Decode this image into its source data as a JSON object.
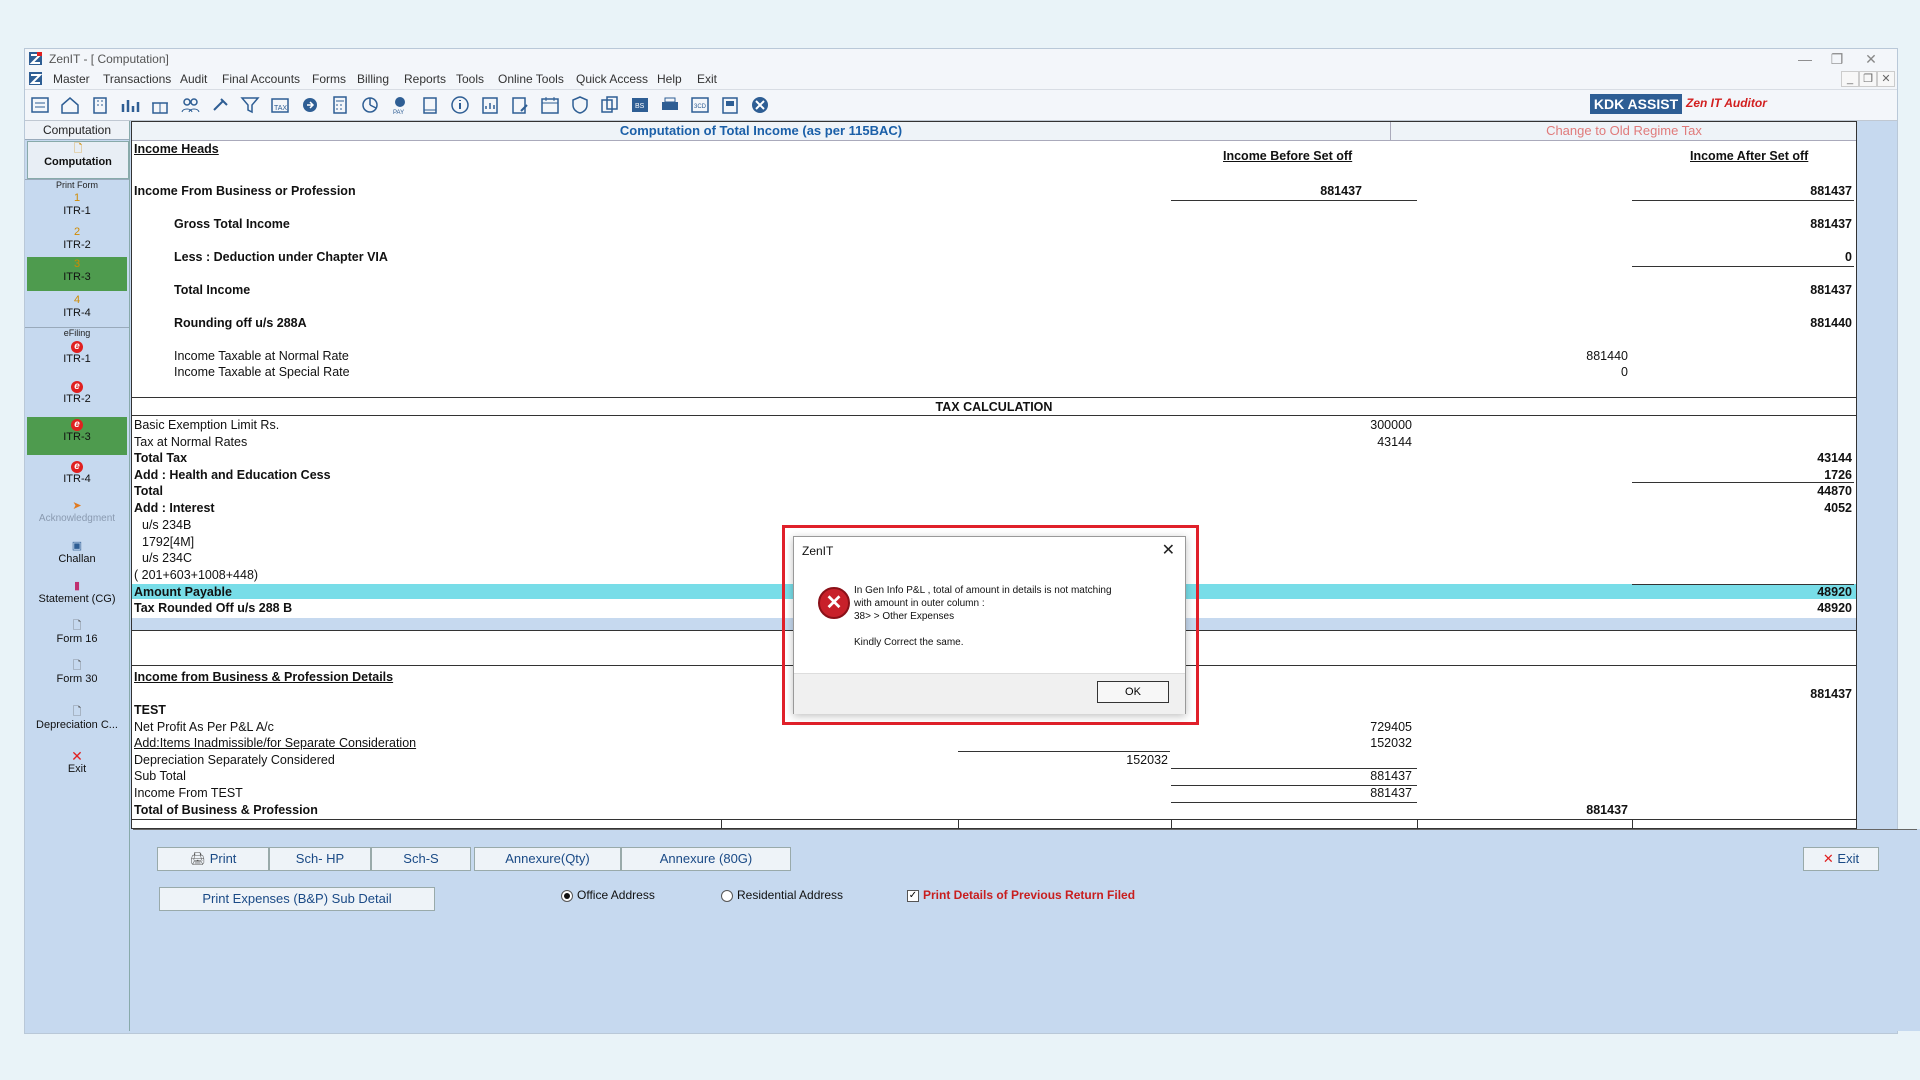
{
  "app": {
    "title": "ZenIT - [ Computation]"
  },
  "menu": [
    "Master",
    "Transactions",
    "Audit",
    "Final Accounts",
    "Forms",
    "Billing",
    "Reports",
    "Tools",
    "Online Tools",
    "Quick Access",
    "Help",
    "Exit"
  ],
  "branding": {
    "kdk": "KDK ASSIST",
    "zen": "Zen IT Auditor"
  },
  "sidebar": {
    "header": "Computation",
    "computation": "Computation",
    "print_form": "Print Form",
    "itr": [
      {
        "num": "1",
        "label": "ITR-1"
      },
      {
        "num": "2",
        "label": "ITR-2"
      },
      {
        "num": "3",
        "label": "ITR-3"
      },
      {
        "num": "4",
        "label": "ITR-4"
      }
    ],
    "efiling": "eFiling",
    "efile": [
      "ITR-1",
      "ITR-2",
      "ITR-3",
      "ITR-4"
    ],
    "acknowledgment": "Acknowledgment",
    "challan": "Challan",
    "statement": "Statement (CG)",
    "form16": "Form 16",
    "form30": "Form 30",
    "depreciation": "Depreciation C...",
    "exit": "Exit"
  },
  "sheet": {
    "title": "Computation of Total Income (as per 115BAC)",
    "old_regime": "Change to Old Regime Tax",
    "income_heads": "Income Heads",
    "col_before": "Income Before Set off",
    "col_after": "Income After Set off",
    "business_income_label": "Income From Business or Profession",
    "business_income_before": "881437",
    "business_income_after": "881437",
    "gti_label": "Gross Total Income",
    "gti_value": "881437",
    "deduction_label": "Less : Deduction under Chapter VIA",
    "deduction_value": "0",
    "total_income_label": "Total Income",
    "total_income_value": "881437",
    "rounding_label": "Rounding off u/s 288A",
    "rounding_value": "881440",
    "normal_rate_label": "Income Taxable at Normal Rate",
    "normal_rate_value": "881440",
    "special_rate_label": "Income Taxable at Special Rate",
    "special_rate_value": "0",
    "tax_calc": "TAX CALCULATION",
    "exemption_label": "Basic Exemption Limit Rs.",
    "exemption_value": "300000",
    "tax_normal_label": "Tax at Normal Rates",
    "tax_normal_value": "43144",
    "total_tax_label": "Total Tax",
    "total_tax_value": "43144",
    "cess_label": "Add : Health and Education Cess",
    "cess_value": "1726",
    "total_label": "Total",
    "total_value": "44870",
    "interest_label": "Add : Interest",
    "interest_value": "4052",
    "u234b": "u/s 234B",
    "m1792": "1792[4M]",
    "u234c": "u/s 234C",
    "breakup": "(  201+603+1008+448)",
    "payable_label": "Amount Payable",
    "payable_value": "48920",
    "rounded_label": "Tax Rounded Off u/s 288 B",
    "rounded_value": "48920",
    "bp_details": "Income from Business & Profession Details",
    "bp_total_top": "881437",
    "test": "TEST",
    "net_profit_label": "Net Profit As Per P&L A/c",
    "net_profit_value": "729405",
    "inadmissible_label": "Add:Items Inadmissible/for Separate Consideration",
    "inadmissible_value": "152032",
    "depr_label": "Depreciation Separately Considered",
    "depr_value": "152032",
    "subtotal_label": "Sub Total",
    "subtotal_value": "881437",
    "income_test_label": "Income From TEST",
    "income_test_value": "881437",
    "total_bp_label": "Total of Business & Profession",
    "total_bp_value": "881437"
  },
  "bottom": {
    "print": "Print",
    "sch_hp": "Sch- HP",
    "sch_s": "Sch-S",
    "annex_qty": "Annexure(Qty)",
    "annex_80g": "Annexure (80G)",
    "exit": "Exit",
    "print_expenses": "Print Expenses (B&P) Sub Detail",
    "office": "Office Address",
    "residential": "Residential Address",
    "prev_return": "Print Details of Previous Return Filed"
  },
  "dialog": {
    "title": "ZenIT",
    "line1": "In Gen Info P&L , total of amount in details is not matching",
    "line2": "with amount in outer column :",
    "line3": "38> > Other Expenses",
    "line4": "Kindly Correct the same.",
    "ok": "OK"
  },
  "colors": {
    "accent": "#1a5fa8",
    "highlight": "#78dde8",
    "active": "#4e9b4e",
    "alert": "#e0202a"
  }
}
